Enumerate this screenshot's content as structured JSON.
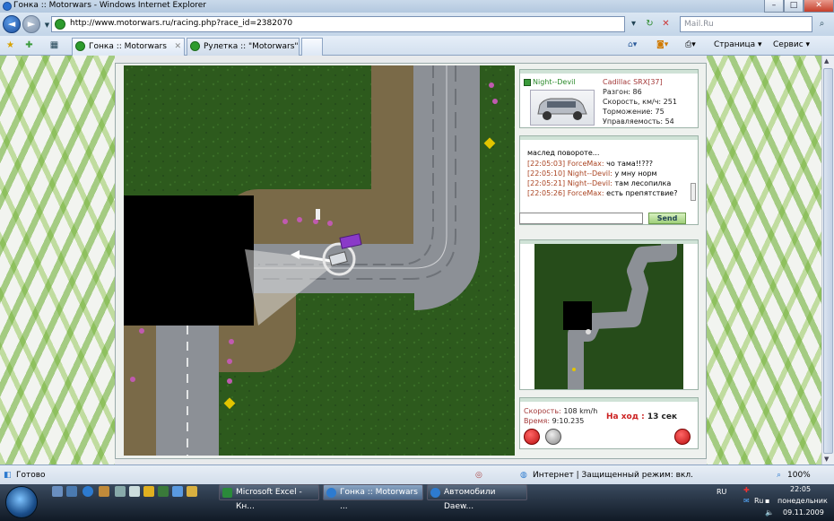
{
  "window": {
    "title": "Гонка :: Motorwars - Windows Internet Explorer",
    "min_label": "–",
    "max_label": "□",
    "close_label": "✕"
  },
  "address_bar": {
    "url": "http://www.motorwars.ru/racing.php?race_id=2382070",
    "search_placeholder": "Mail.Ru"
  },
  "tabs": [
    {
      "label": "Гонка :: Motorwars",
      "active": true
    },
    {
      "label": "Рулетка :: \"Motorwars\"",
      "active": false
    }
  ],
  "commands": {
    "page_label": "Страница",
    "service_label": "Сервис"
  },
  "player": {
    "nick": "Night--Devil",
    "car": "Cadillac SRX[37]",
    "stats": [
      "Разгон: 86",
      "Скорость, км/ч: 251",
      "Торможение: 75",
      "Управляемость: 54"
    ]
  },
  "chat": {
    "lines": [
      {
        "time": "",
        "name": "",
        "text": "маслед повороте..."
      },
      {
        "time": "[22:05:03]",
        "name": "ForceMax:",
        "text": "чо тама!!???"
      },
      {
        "time": "[22:05:10]",
        "name": "Night--Devil:",
        "text": "у мну норм"
      },
      {
        "time": "[22:05:21]",
        "name": "Night--Devil:",
        "text": "там лесопилка"
      },
      {
        "time": "[22:05:26]",
        "name": "ForceMax:",
        "text": "есть препятствие?"
      }
    ],
    "send_label": "Send"
  },
  "race_info": {
    "speed_label": "Скорость:",
    "speed_value": "108 km/h",
    "time_label": "Время:",
    "time_value": "9:10.235",
    "turn_label": "На ход :",
    "turn_value": "13 сек"
  },
  "status_bar": {
    "text": "Готово",
    "zone": "Интернет | Защищенный режим: вкл.",
    "zoom": "100%"
  },
  "taskbar": {
    "items": [
      {
        "label": "Microsoft Excel - Кн...",
        "active": false
      },
      {
        "label": "Гонка :: Motorwars ...",
        "active": true
      },
      {
        "label": "Автомобили Daew...",
        "active": false
      }
    ],
    "lang": "RU",
    "tray_lang": "Ru",
    "time": "22:05",
    "day": "понедельник",
    "date": "09.11.2009"
  },
  "colors": {
    "grass": "#2d5a1d",
    "road": "#8c9096",
    "accent_red": "#c22222",
    "player_car": "#8a3ac8"
  }
}
